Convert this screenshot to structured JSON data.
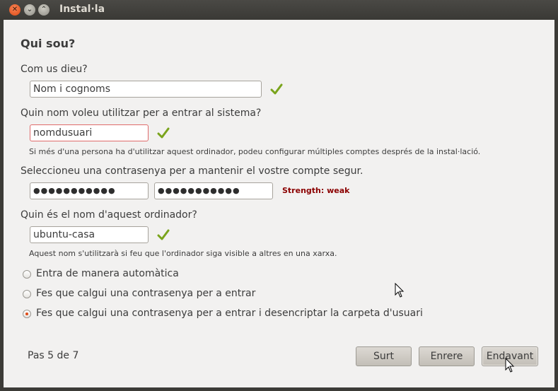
{
  "window": {
    "title": "Instal·la"
  },
  "page": {
    "heading": "Qui sou?",
    "name": {
      "label": "Com us dieu?",
      "value": "Nom i cognoms"
    },
    "username": {
      "label": "Quin nom voleu utilitzar per a entrar al sistema?",
      "value": "nomdusuari",
      "hint": "Si més d'una persona ha d'utilitzar aquest ordinador, podeu configurar múltiples comptes després de la instal·lació."
    },
    "password": {
      "label": "Seleccioneu una contrasenya per a mantenir el vostre compte segur.",
      "value_masked": "●●●●●●●●●●●",
      "confirm_masked": "●●●●●●●●●●●",
      "strength": "Strength: weak"
    },
    "hostname": {
      "label": "Quin és el nom d'aquest ordinador?",
      "value": "ubuntu-casa",
      "hint": "Aquest nom s'utilitzarà si feu que l'ordinador siga visible a altres en una xarxa."
    },
    "login_options": [
      {
        "label": "Entra de manera automàtica",
        "selected": false
      },
      {
        "label": "Fes que calgui una contrasenya per a entrar",
        "selected": false
      },
      {
        "label": "Fes que calgui una contrasenya per a entrar i desencriptar la carpeta d'usuari",
        "selected": true
      }
    ],
    "step": "Pas 5 de 7"
  },
  "buttons": {
    "quit": "Surt",
    "back": "Enrere",
    "forward": "Endavant"
  },
  "colors": {
    "accent": "#df4a16",
    "check": "#7aa41c",
    "strength_weak": "#8b0000",
    "error_border": "#df6b6b"
  },
  "icons": {
    "check": "check-icon",
    "cursor": "mouse-pointer-icon"
  }
}
